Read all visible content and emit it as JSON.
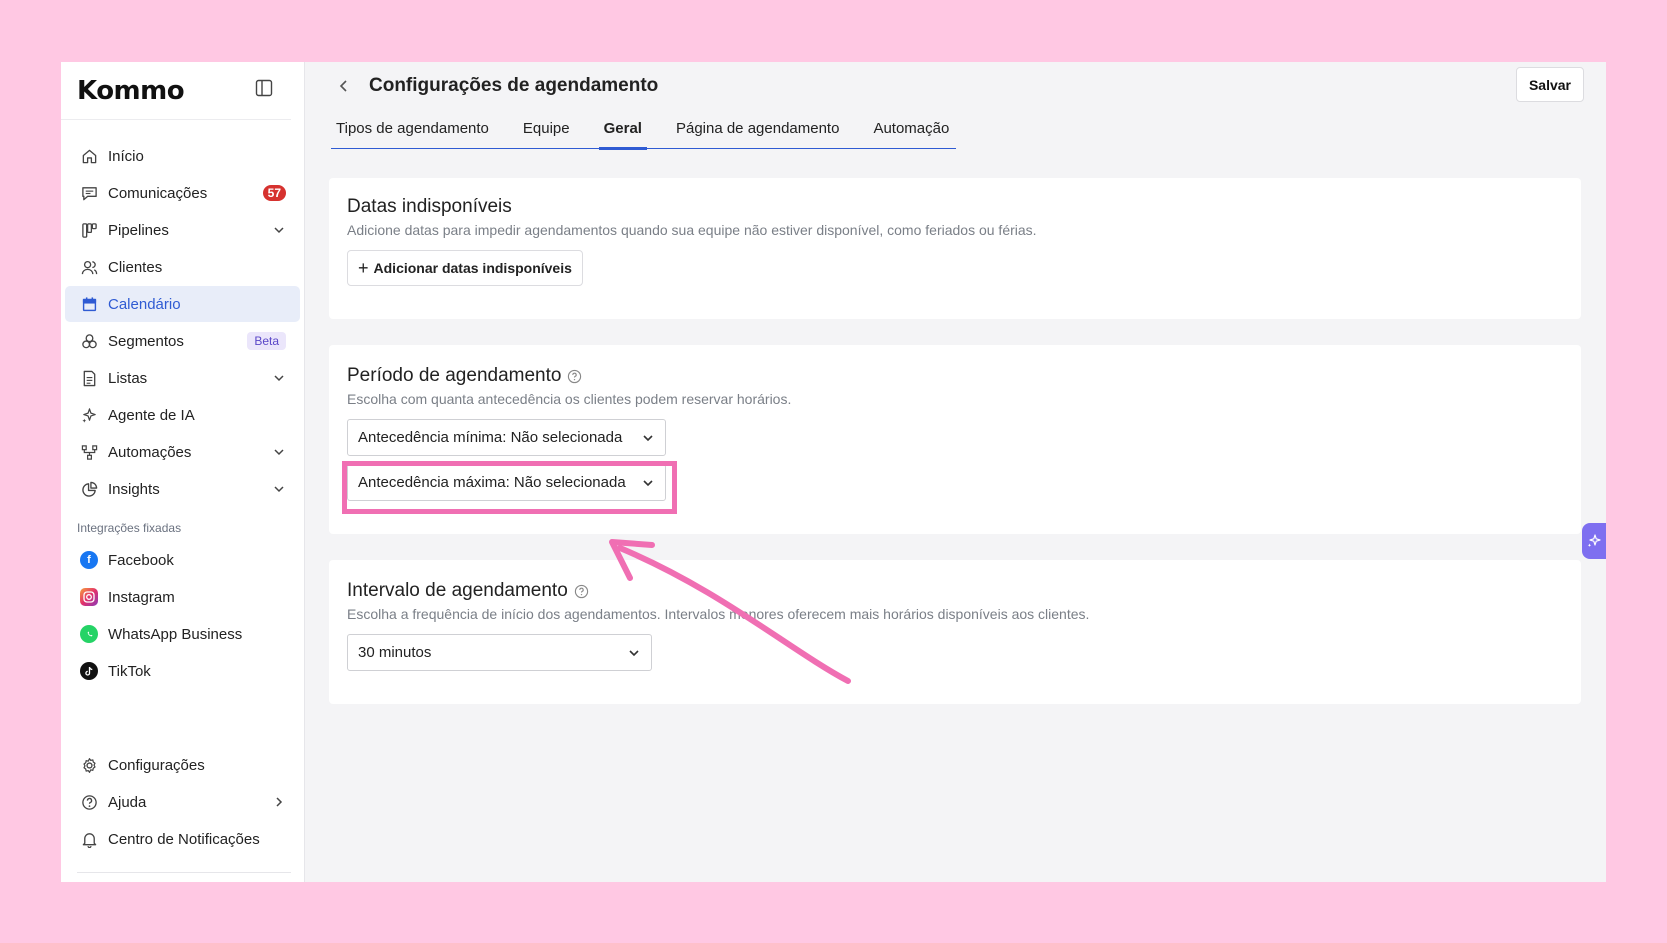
{
  "brand": {
    "logo_text": "Kommo"
  },
  "sidebar": {
    "items": [
      {
        "label": "Início",
        "icon": "home-icon"
      },
      {
        "label": "Comunicações",
        "icon": "chat-icon",
        "badge": "57"
      },
      {
        "label": "Pipelines",
        "icon": "pipeline-icon",
        "expandable": true
      },
      {
        "label": "Clientes",
        "icon": "users-icon"
      },
      {
        "label": "Calendário",
        "icon": "calendar-icon",
        "active": true
      },
      {
        "label": "Segmentos",
        "icon": "segments-icon",
        "tag": "Beta"
      },
      {
        "label": "Listas",
        "icon": "list-icon",
        "expandable": true
      },
      {
        "label": "Agente de IA",
        "icon": "sparkle-icon"
      },
      {
        "label": "Automações",
        "icon": "automation-icon",
        "expandable": true
      },
      {
        "label": "Insights",
        "icon": "pie-chart-icon",
        "expandable": true
      }
    ],
    "integrations_label": "Integrações fixadas",
    "integrations": [
      {
        "label": "Facebook",
        "icon": "facebook-icon",
        "color": "#1877f2"
      },
      {
        "label": "Instagram",
        "icon": "instagram-icon",
        "color": "#e1306c"
      },
      {
        "label": "WhatsApp Business",
        "icon": "whatsapp-icon",
        "color": "#25d366"
      },
      {
        "label": "TikTok",
        "icon": "tiktok-icon",
        "color": "#111111"
      }
    ],
    "bottom_items": [
      {
        "label": "Configurações",
        "icon": "gear-icon"
      },
      {
        "label": "Ajuda",
        "icon": "help-icon",
        "submenu": true
      },
      {
        "label": "Centro de Notificações",
        "icon": "bell-icon"
      }
    ]
  },
  "header": {
    "title": "Configurações de agendamento",
    "save_label": "Salvar"
  },
  "tabs": [
    {
      "label": "Tipos de agendamento"
    },
    {
      "label": "Equipe"
    },
    {
      "label": "Geral",
      "active": true
    },
    {
      "label": "Página de agendamento"
    },
    {
      "label": "Automação"
    }
  ],
  "unavailable": {
    "title": "Datas indisponíveis",
    "description": "Adicione datas para impedir agendamentos quando sua equipe não estiver disponível, como feriados ou férias.",
    "add_label": "Adicionar datas indisponíveis"
  },
  "period": {
    "title": "Período de agendamento",
    "description": "Escolha com quanta antecedência os clientes podem reservar horários.",
    "min_select": "Antecedência mínima: Não selecionada",
    "max_select": "Antecedência máxima: Não selecionada"
  },
  "interval": {
    "title": "Intervalo de agendamento",
    "description": "Escolha a frequência de início dos agendamentos. Intervalos menores oferecem mais horários disponíveis aos clientes.",
    "select": "30 minutos"
  },
  "colors": {
    "accent": "#2f5bd3",
    "highlight": "#f06fb3",
    "background": "#ffc8e3",
    "badge": "#d6322f"
  }
}
